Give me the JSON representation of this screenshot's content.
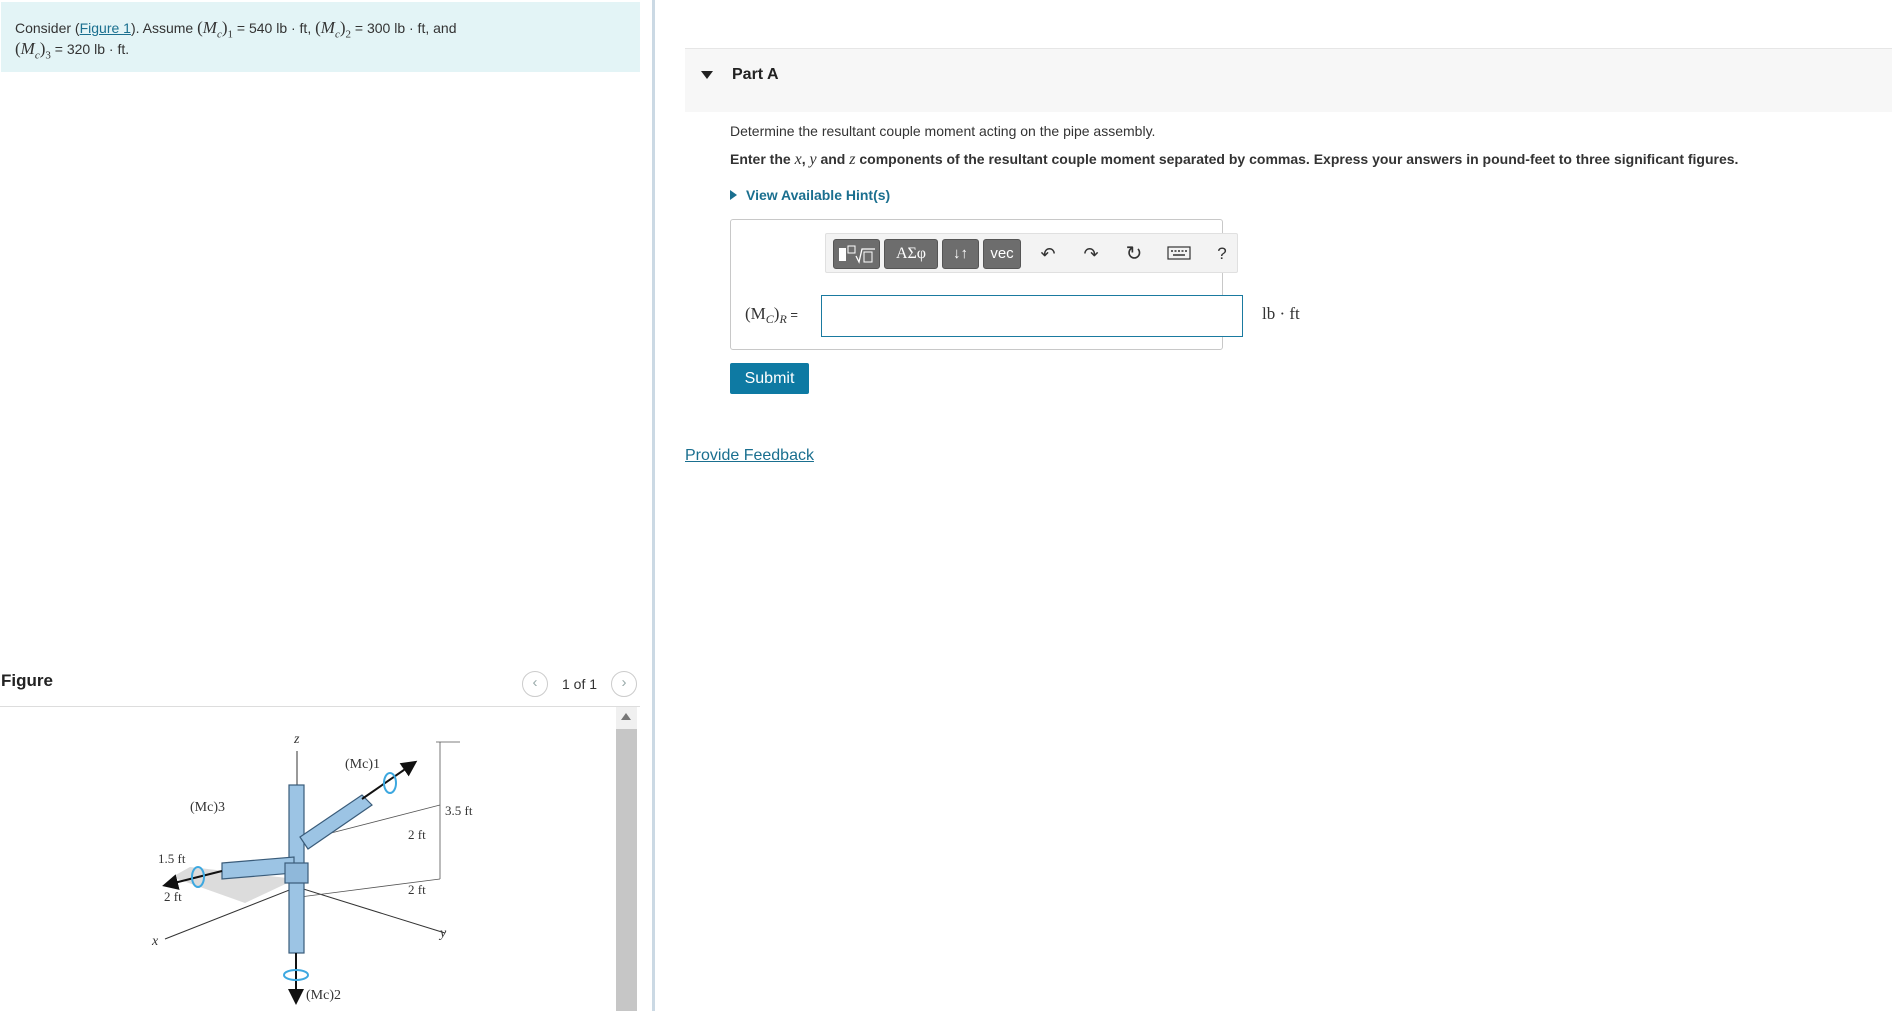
{
  "problem": {
    "prefix": "Consider (",
    "figure_link": "Figure 1",
    "after_link": "). Assume ",
    "m1_label": "(Mc)1",
    "m1_value": " = 540 lb · ft",
    "m2_label": "(Mc)2",
    "m2_value": " = 300 lb · ft",
    "and_text": ", and",
    "m3_label": "(Mc)3",
    "m3_value": " = 320 lb · ft."
  },
  "figure": {
    "title": "Figure",
    "pager": "1 of 1",
    "labels": {
      "z": "z",
      "x": "x",
      "y": "y",
      "mc1": "(Mc)1",
      "mc2": "(Mc)2",
      "mc3": "(Mc)3",
      "d_15ft": "1.5 ft",
      "d_2ft_a": "2 ft",
      "d_2ft_b": "2 ft",
      "d_2ft_c": "2 ft",
      "d_35ft": "3.5 ft"
    },
    "pipe_color": "#9cc4e4"
  },
  "part": {
    "title": "Part A",
    "question": "Determine the resultant couple moment acting on the pipe assembly.",
    "instruction_pre": "Enter the ",
    "var_x": "x",
    "sep1": ", ",
    "var_y": "y",
    "and_text": " and ",
    "var_z": "z",
    "instruction_post": " components of the resultant couple moment separated by commas. Express your answers in pound-feet to three significant figures.",
    "hint_label": "View Available Hint(s)",
    "toolbar": {
      "template_icon": "templates-icon",
      "greek_label": "ΑΣφ",
      "arrows_label": "↓↑",
      "vec_label": "vec",
      "undo": "↶",
      "redo": "↷",
      "reset": "↻",
      "keyboard_icon": "keyboard-icon",
      "help": "?"
    },
    "equation_label": "(M",
    "equation_sub_c": "C",
    "equation_close": ")",
    "equation_sub_r": "R",
    "equation_equals": " =",
    "answer_value": "",
    "unit": "lb · ft",
    "submit_label": "Submit",
    "feedback_label": "Provide Feedback"
  },
  "colors": {
    "accent": "#0e7aa3",
    "link": "#1a6f8f",
    "problem_bg": "#e3f4f6"
  }
}
